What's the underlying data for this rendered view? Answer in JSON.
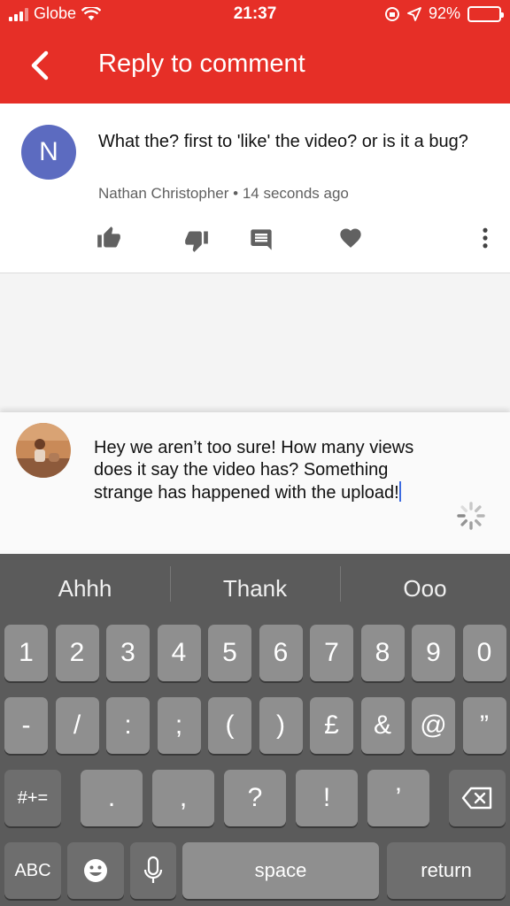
{
  "status_bar": {
    "carrier": "Globe",
    "time": "21:37",
    "battery": "92%",
    "battery_level": 0.92
  },
  "header": {
    "title": "Reply to comment",
    "back_icon": "chevron-left-icon"
  },
  "comment": {
    "avatar_initial": "N",
    "text": "What the? first to 'like' the video? or is it a bug?",
    "author": "Nathan Christopher",
    "separator": "•",
    "time": "14 seconds ago",
    "actions": [
      "thumb-up-icon",
      "thumb-down-icon",
      "reply-icon",
      "heart-icon",
      "more-vert-icon"
    ]
  },
  "reply": {
    "text": "Hey we aren’t too sure! How many views does it say the video has? Something strange has happened with the upload!"
  },
  "keyboard": {
    "suggestions": [
      "Ahhh",
      "Thank",
      "Ooo"
    ],
    "row1": [
      "1",
      "2",
      "3",
      "4",
      "5",
      "6",
      "7",
      "8",
      "9",
      "0"
    ],
    "row2": [
      "-",
      "/",
      ":",
      ";",
      "(",
      ")",
      "£",
      "&",
      "@",
      "”"
    ],
    "row3": {
      "shift": "#+=",
      "keys": [
        ".",
        ",",
        "?",
        "!",
        "’"
      ],
      "delete_icon": "backspace-icon"
    },
    "row4": {
      "abc": "ABC",
      "emoji_icon": "emoji-icon",
      "mic_icon": "microphone-icon",
      "space": "space",
      "return": "return"
    }
  },
  "colors": {
    "accent": "#e62f27",
    "avatar": "#5c6bc0",
    "keyboard_bg": "#5b5b5b",
    "key_bg": "#8f8f8f",
    "caret": "#3d6be0"
  }
}
